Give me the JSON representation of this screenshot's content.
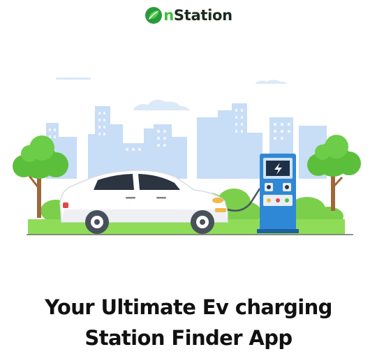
{
  "brand": {
    "name_accent": "n",
    "name_rest": "Station",
    "logo_icon": "leaf-o-icon",
    "accent_color": "#3fbf3f"
  },
  "hero": {
    "illustration": "ev-charging-scene",
    "icons": [
      "city-skyline",
      "tree-icon",
      "car-icon",
      "charging-station-icon",
      "lightning-bolt-icon"
    ]
  },
  "headline": {
    "line1": "Your Ultimate Ev charging",
    "line2": "Station Finder App"
  }
}
